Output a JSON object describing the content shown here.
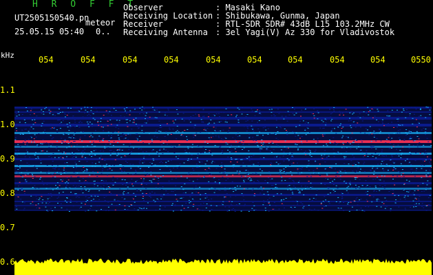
{
  "header": {
    "app_title": "H R O F F T",
    "filename": "UT2505150540.pn",
    "mode": "meteor",
    "datetime": "25.05.15 05:40",
    "index": "0.."
  },
  "info": {
    "labels": [
      "Observer",
      "Receiving Location",
      "Receiver",
      "Receiving Antenna"
    ],
    "values": [
      ": Masaki Kano",
      ": Shibukawa, Gunma, Japan",
      ": RTL-SDR SDR# 43dB L15 103.2MHz CW",
      ": 3el Yagi(V) Az 330 for Vladivostok"
    ]
  },
  "axes": {
    "y_unit": "kHz",
    "y_ticks": [
      "1.1",
      "1.0",
      "0.9",
      "0.8",
      "0.7",
      "0.6"
    ],
    "x_ticks": [
      "054",
      "054",
      "054",
      "054",
      "054",
      "054",
      "054",
      "054",
      "054",
      "0550"
    ]
  },
  "colors": {
    "background": "#000000",
    "title": "#33cc33",
    "text": "#ffffff",
    "axis": "#ffff00",
    "signal_low": "#0a1a8c",
    "signal_mid": "#19b8ff",
    "signal_high": "#ff3355",
    "noise_bar": "#ffff00"
  }
}
